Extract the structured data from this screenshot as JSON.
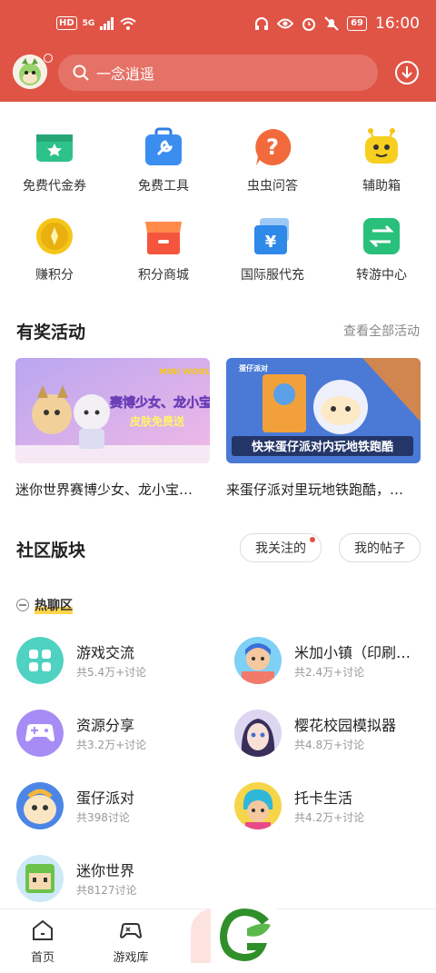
{
  "status_bar": {
    "hd": "HD",
    "signal": "5G",
    "battery": "69",
    "time": "16:00"
  },
  "header": {
    "search_placeholder": "一念逍遥",
    "colors": {
      "brand": "#e05446"
    }
  },
  "quick_grid": [
    {
      "label": "免费代金券",
      "icon": "voucher-icon"
    },
    {
      "label": "免费工具",
      "icon": "toolbox-icon"
    },
    {
      "label": "虫虫问答",
      "icon": "question-icon"
    },
    {
      "label": "辅助箱",
      "icon": "robot-icon"
    },
    {
      "label": "赚积分",
      "icon": "coin-icon"
    },
    {
      "label": "积分商城",
      "icon": "shop-icon"
    },
    {
      "label": "国际服代充",
      "icon": "yen-card-icon"
    },
    {
      "label": "转游中心",
      "icon": "transfer-icon"
    }
  ],
  "activities": {
    "title": "有奖活动",
    "see_all": "查看全部活动",
    "items": [
      {
        "banner_text": "赛博少女、龙小宝",
        "banner_sub": "皮肤免费送",
        "banner_logo": "MINI WORLD",
        "caption": "迷你世界赛博少女、龙小宝…"
      },
      {
        "banner_text": "快来蛋仔派对内玩地铁跑酷",
        "banner_logo": "蛋仔派对",
        "caption": "来蛋仔派对里玩地铁跑酷，…"
      }
    ]
  },
  "community": {
    "title": "社区版块",
    "tabs": [
      "我关注的",
      "我的帖子"
    ],
    "hot_label": "热聊区",
    "items": [
      {
        "name": "游戏交流",
        "count": "共5.4万+讨论"
      },
      {
        "name": "米加小镇（印刷…",
        "count": "共2.4万+讨论"
      },
      {
        "name": "资源分享",
        "count": "共3.2万+讨论"
      },
      {
        "name": "樱花校园模拟器",
        "count": "共4.8万+讨论"
      },
      {
        "name": "蛋仔派对",
        "count": "共398讨论"
      },
      {
        "name": "托卡生活",
        "count": "共4.2万+讨论"
      },
      {
        "name": "迷你世界",
        "count": "共8127讨论"
      }
    ]
  },
  "bottom_nav": [
    {
      "label": "首页",
      "icon": "home-icon"
    },
    {
      "label": "游戏库",
      "icon": "gamepad-icon"
    }
  ]
}
